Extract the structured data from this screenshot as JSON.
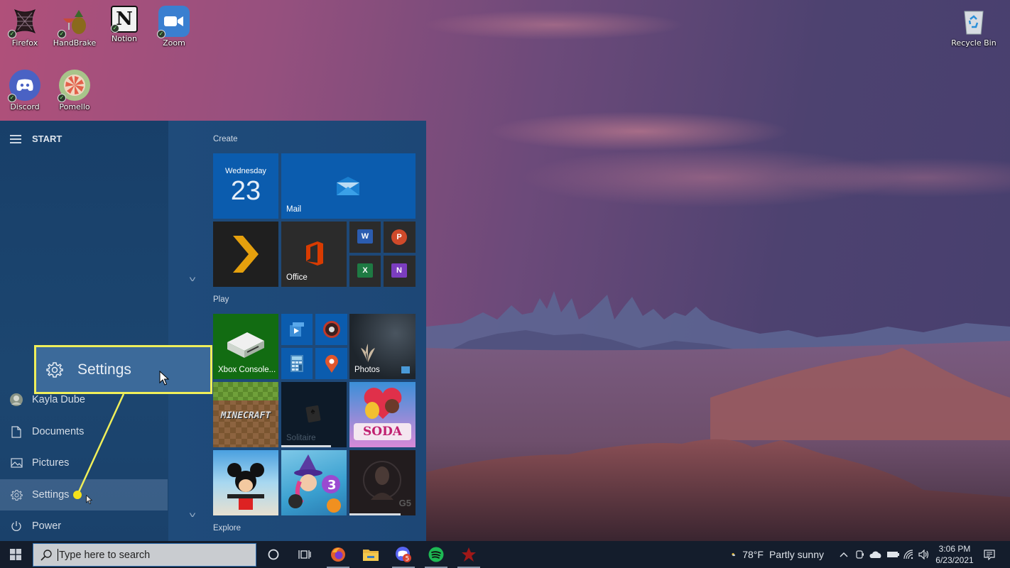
{
  "desktop": {
    "icons": [
      {
        "label": "Firefox",
        "icon": "firefox-icon"
      },
      {
        "label": "HandBrake",
        "icon": "handbrake-icon"
      },
      {
        "label": "Notion",
        "icon": "notion-icon"
      },
      {
        "label": "Zoom",
        "icon": "zoom-icon"
      },
      {
        "label": "Discord",
        "icon": "discord-icon"
      },
      {
        "label": "Pomello",
        "icon": "pomello-icon"
      }
    ],
    "recycle_bin": {
      "label": "Recycle Bin",
      "icon": "recycle-bin-icon"
    }
  },
  "start_menu": {
    "title": "START",
    "nav": [
      {
        "label": "Kayla Dube",
        "icon": "user-avatar-icon"
      },
      {
        "label": "Documents",
        "icon": "document-icon"
      },
      {
        "label": "Pictures",
        "icon": "pictures-icon"
      },
      {
        "label": "Settings",
        "icon": "gear-icon",
        "selected": true
      },
      {
        "label": "Power",
        "icon": "power-icon"
      }
    ],
    "groups": [
      {
        "label": "Create",
        "tiles": [
          {
            "name": "calendar",
            "day_name": "Wednesday",
            "day_number": "23"
          },
          {
            "name": "mail",
            "label": "Mail"
          },
          {
            "name": "plex",
            "label": ""
          },
          {
            "name": "office",
            "label": "Office"
          },
          {
            "name": "word",
            "label": "W"
          },
          {
            "name": "powerpoint",
            "label": "P"
          },
          {
            "name": "excel",
            "label": "X"
          },
          {
            "name": "onenote",
            "label": "N"
          }
        ]
      },
      {
        "label": "Play",
        "tiles": [
          {
            "name": "xbox-console",
            "label": "Xbox Console..."
          },
          {
            "name": "movies-tv",
            "label": ""
          },
          {
            "name": "groove-music",
            "label": ""
          },
          {
            "name": "calculator",
            "label": ""
          },
          {
            "name": "maps",
            "label": ""
          },
          {
            "name": "photos",
            "label": "Photos"
          },
          {
            "name": "minecraft",
            "label": "MINECRAFT"
          },
          {
            "name": "solitaire",
            "label": "Solitaire"
          },
          {
            "name": "candy-crush-soda",
            "label": "SODA"
          },
          {
            "name": "disney-magic-kingdoms",
            "label": ""
          },
          {
            "name": "bubble-witch-3",
            "label": ""
          },
          {
            "name": "g5-game",
            "label": "G5"
          }
        ]
      },
      {
        "label": "Explore",
        "tiles": []
      }
    ]
  },
  "callout": {
    "label": "Settings",
    "color": "#f0ef5a"
  },
  "taskbar": {
    "search_placeholder": "Type here to search",
    "pinned": [
      {
        "name": "cortana",
        "icon": "cortana-circle-icon"
      },
      {
        "name": "task-view",
        "icon": "task-view-icon"
      },
      {
        "name": "firefox",
        "icon": "firefox-icon",
        "running": true
      },
      {
        "name": "file-explorer",
        "icon": "folder-icon",
        "running": false
      },
      {
        "name": "discord",
        "icon": "discord-icon",
        "running": true,
        "badge": "5"
      },
      {
        "name": "spotify",
        "icon": "spotify-icon",
        "running": true
      },
      {
        "name": "app",
        "icon": "red-app-icon",
        "running": true
      }
    ],
    "weather": {
      "temp": "78°F",
      "condition": "Partly sunny"
    },
    "clock": {
      "time": "3:06 PM",
      "date": "6/23/2021"
    }
  },
  "colors": {
    "accent": "#0b5cae",
    "start_bg": "#1a3e68",
    "taskbar_bg": "#141d2c",
    "highlight": "#f0ef5a"
  }
}
